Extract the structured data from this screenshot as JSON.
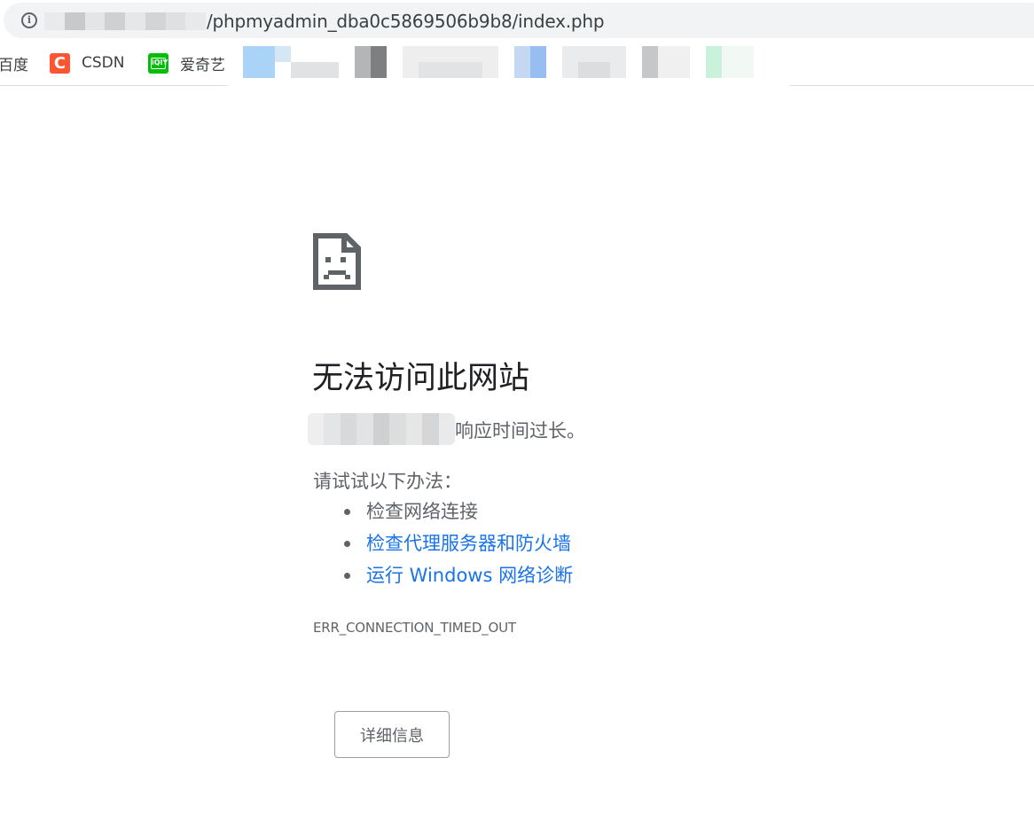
{
  "browser": {
    "url_suffix": "/phpmyadmin_dba0c5869506b9b8/index.php",
    "info_icon": "info-icon",
    "info_glyph": "i"
  },
  "bookmarks": [
    {
      "label": "百度",
      "icon": "baidu-icon"
    },
    {
      "label": "CSDN",
      "icon": "csdn-icon",
      "glyph": "C",
      "color": "#fc5531"
    },
    {
      "label": "爱奇艺",
      "icon": "iqiyi-icon",
      "glyph": "iQIY",
      "color": "#00be06"
    }
  ],
  "error": {
    "icon": "sad-page-icon",
    "title": "无法访问此网站",
    "description": "响应时间过长。",
    "try_label": "请试试以下办法：",
    "suggestions": [
      {
        "text": "检查网络连接",
        "link": false
      },
      {
        "text": "检查代理服务器和防火墙",
        "link": true
      },
      {
        "text": "运行 Windows 网络诊断",
        "link": true
      }
    ],
    "code": "ERR_CONNECTION_TIMED_OUT",
    "details_button": "详细信息"
  },
  "colors": {
    "text": "#202124",
    "secondary_text": "#5f6368",
    "link": "#1a73e8",
    "bar_background": "#f1f3f4"
  }
}
